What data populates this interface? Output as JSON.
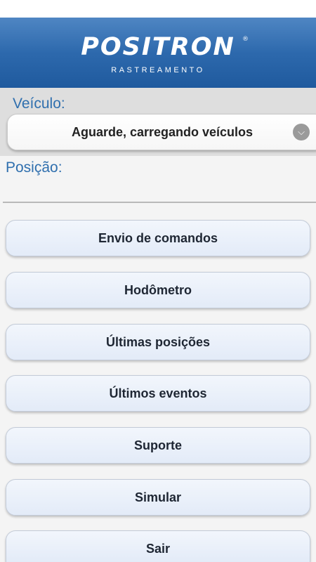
{
  "header": {
    "logo_text": "POSITRON",
    "logo_mark": "®",
    "logo_subtitle": "RASTREAMENTO"
  },
  "vehicle": {
    "label": "Veículo:",
    "value": "Aguarde, carregando veículos",
    "dropdown_icon": "chevron-down-icon"
  },
  "position": {
    "label": "Posição:"
  },
  "menu": {
    "items": [
      {
        "label": "Envio de comandos"
      },
      {
        "label": "Hodômetro"
      },
      {
        "label": "Últimas posições"
      },
      {
        "label": "Últimos eventos"
      },
      {
        "label": "Suporte"
      },
      {
        "label": "Simular"
      },
      {
        "label": "Sair"
      }
    ]
  },
  "colors": {
    "header_blue": "#2d69ad",
    "label_blue": "#2f6fae",
    "button_bg": "#e3ebf8"
  }
}
